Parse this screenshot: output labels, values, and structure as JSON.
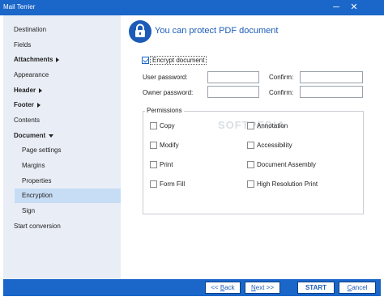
{
  "window": {
    "title": "Mail Terrier",
    "minimize": "─",
    "close": "✕"
  },
  "sidebar": {
    "items": [
      {
        "label": "Destination"
      },
      {
        "label": "Fields"
      },
      {
        "label": "Attachments"
      },
      {
        "label": "Appearance"
      },
      {
        "label": "Header"
      },
      {
        "label": "Footer"
      },
      {
        "label": "Contents"
      },
      {
        "label": "Document"
      },
      {
        "label": "Page settings"
      },
      {
        "label": "Margins"
      },
      {
        "label": "Properties"
      },
      {
        "label": "Encryption"
      },
      {
        "label": "Sign"
      },
      {
        "label": "Start conversion"
      }
    ],
    "selected": "Encryption"
  },
  "main": {
    "header": "You can protect PDF document",
    "encrypt": {
      "label": "Encrypt document",
      "checked": true
    },
    "user_password_label": "User password:",
    "owner_password_label": "Owner password:",
    "confirm_label": "Confirm:",
    "user_password_value": "",
    "owner_password_value": "",
    "permissions": {
      "legend": "Permissions",
      "items": [
        {
          "label": "Copy",
          "checked": false
        },
        {
          "label": "Annotation",
          "checked": false
        },
        {
          "label": "Modify",
          "checked": false
        },
        {
          "label": "Accessibility",
          "checked": false
        },
        {
          "label": "Print",
          "checked": false
        },
        {
          "label": "Document Assembly",
          "checked": false
        },
        {
          "label": "Form Fill",
          "checked": false
        },
        {
          "label": "High Resolution Print",
          "checked": false
        }
      ]
    },
    "watermark": "SOFTPEDIA"
  },
  "footer": {
    "back_prefix": "<< ",
    "back_key": "B",
    "back_rest": "ack",
    "next_key": "N",
    "next_rest": "ext >>",
    "start": "START",
    "cancel_key": "C",
    "cancel_rest": "ancel"
  },
  "colors": {
    "accent": "#1a66c9",
    "sidebar_bg": "#e9eef6",
    "selected_bg": "#c7ddf5"
  }
}
